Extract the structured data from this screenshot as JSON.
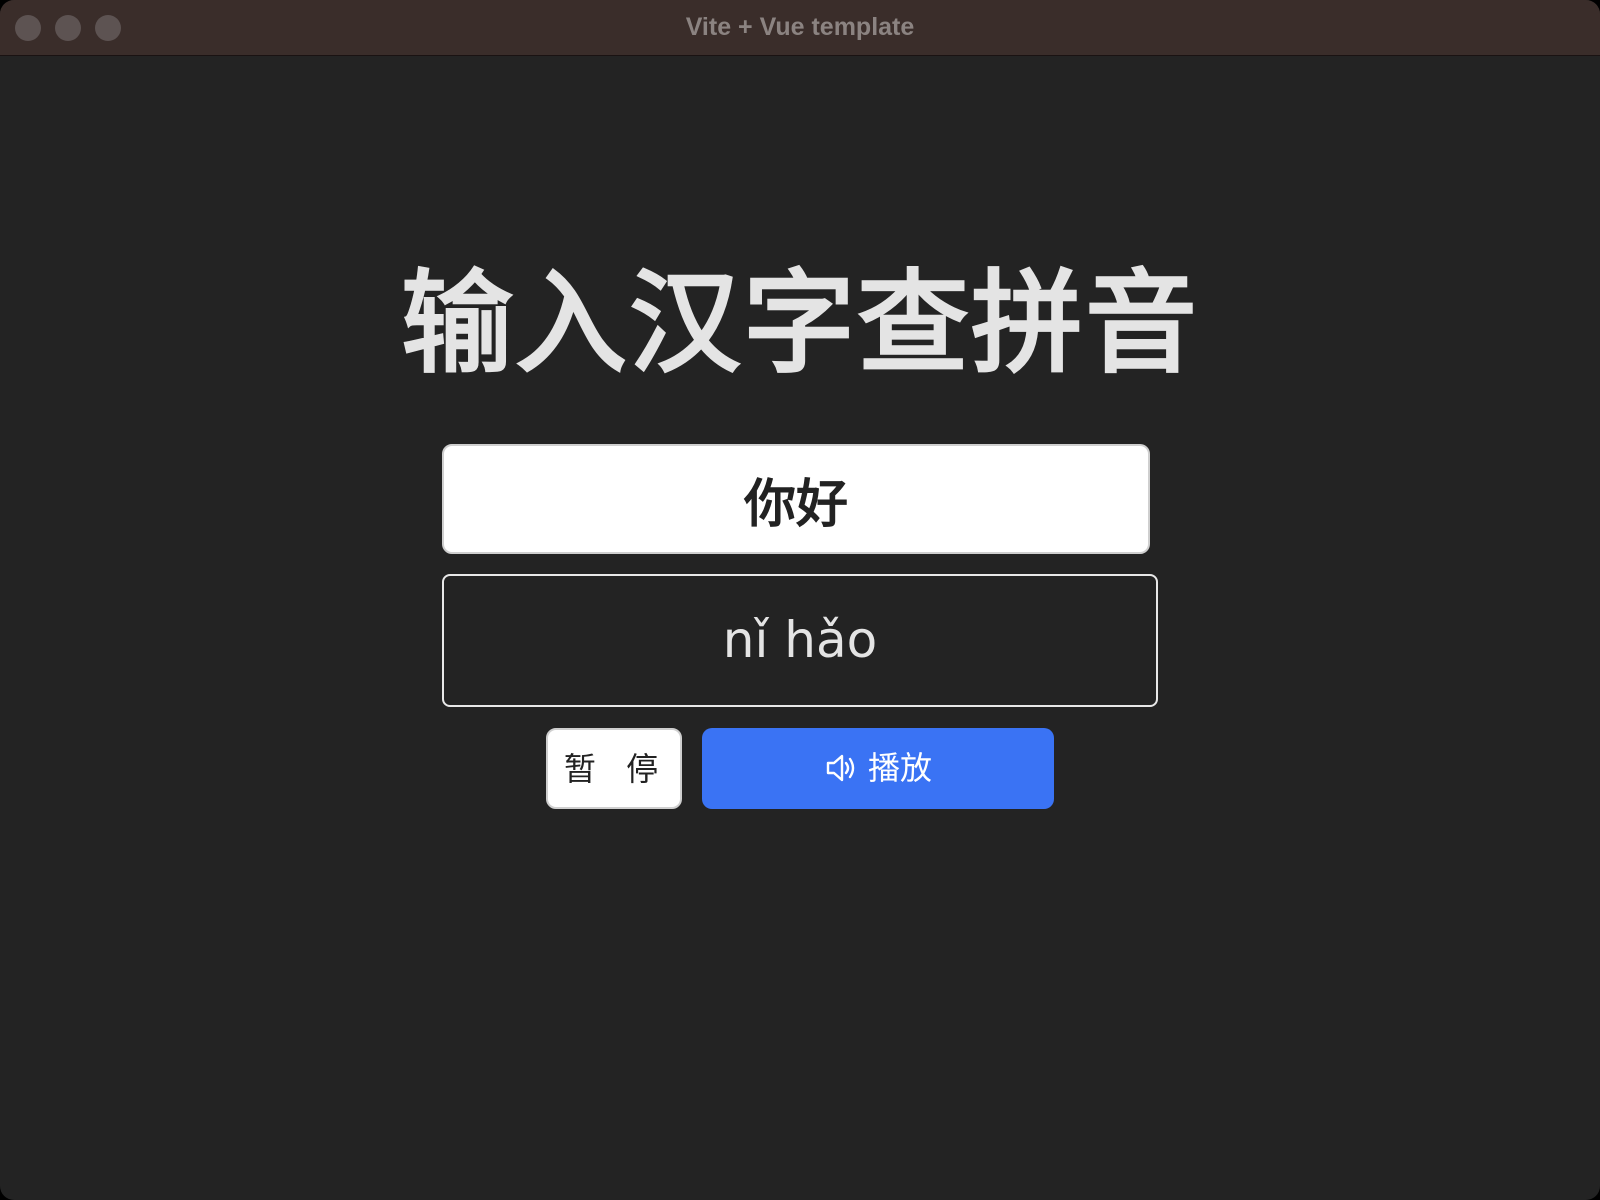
{
  "window": {
    "title": "Vite + Vue template"
  },
  "main": {
    "heading": "输入汉字查拼音",
    "hanzi_input": {
      "value": "你好",
      "placeholder": ""
    },
    "pinyin_output": "nǐ hǎo",
    "pause_button": {
      "label": "暂 停"
    },
    "play_button": {
      "label": "播放",
      "icon": "speaker-icon"
    }
  },
  "colors": {
    "background": "#232323",
    "titlebar": "#3a2d2a",
    "accent": "#3a73f4",
    "text": "#e4e4e4"
  }
}
